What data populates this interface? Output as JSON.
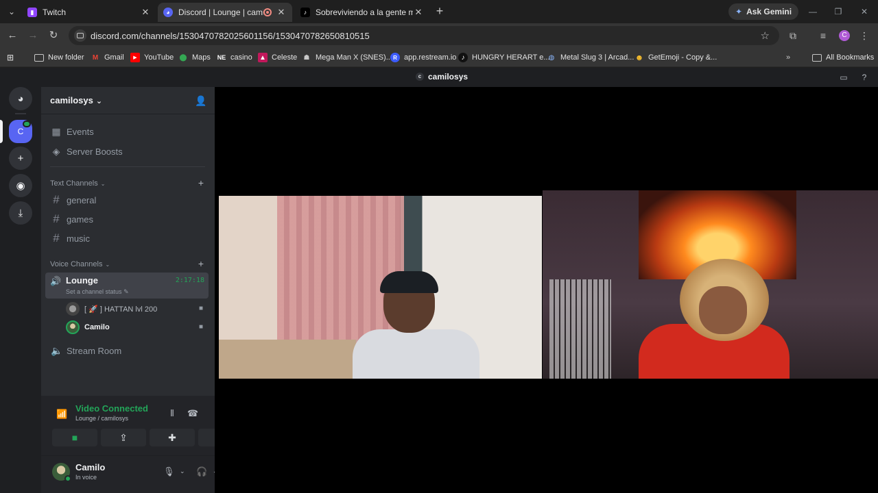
{
  "browser": {
    "tabs": [
      {
        "title": "Twitch",
        "active": false
      },
      {
        "title": "Discord | Lounge | camilosys",
        "active": true
      },
      {
        "title": "Sobreviviendo a la gente más t",
        "active": false
      }
    ],
    "ask_gemini": "Ask Gemini",
    "url": "discord.com/channels/1530470782025601156/1530470782650810515",
    "profile_initial": "C",
    "bookmarks": [
      "New folder",
      "Gmail",
      "YouTube",
      "Maps",
      "casino",
      "Celeste",
      "Mega Man X (SNES)...",
      "app.restream.io",
      "HUNGRY HERART e...",
      "Metal Slug 3 | Arcad...",
      "GetEmoji - Copy &..."
    ],
    "bookmark_icon_letters": [
      "M",
      "NE",
      "R"
    ],
    "all_bookmarks": "All Bookmarks"
  },
  "discord": {
    "titlebar_server": "camilosys",
    "titlebar_server_initial": "c",
    "guild_current_initial": "C",
    "server_name": "camilosys",
    "nav_items": [
      "Events",
      "Server Boosts"
    ],
    "text_category": "Text Channels",
    "text_channels": [
      "general",
      "games",
      "music"
    ],
    "voice_category": "Voice Channels",
    "voice_channel": {
      "name": "Lounge",
      "timer": "2:17:18",
      "status": "Set a channel status",
      "users": [
        {
          "name": "[ 🚀 ] HATTAN lvl 200",
          "bold": false
        },
        {
          "name": "Camilo",
          "bold": true
        }
      ]
    },
    "stream_room": "Stream Room",
    "voice_panel": {
      "title": "Video Connected",
      "subtitle": "Lounge / camilosys"
    },
    "user": {
      "name": "Camilo",
      "status": "In voice"
    },
    "colors": {
      "blurple": "#5865f2",
      "green": "#23a559",
      "sidebar": "#2b2d31",
      "guild_rail": "#1e1f22"
    }
  }
}
